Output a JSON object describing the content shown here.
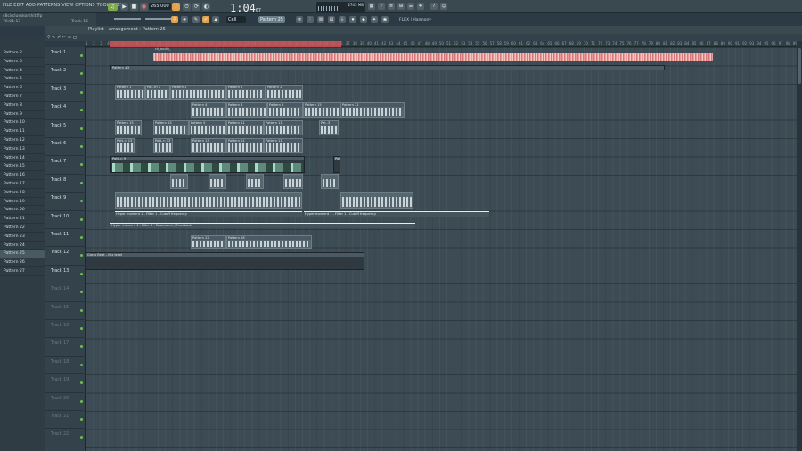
{
  "menu": [
    "FILE",
    "EDIT",
    "ADD",
    "PATTERNS",
    "VIEW",
    "OPTIONS",
    "TOOLS",
    "HELP"
  ],
  "info": {
    "project": "c8circlusskorshit.flp",
    "position": "76:01:13",
    "track_hint": "Track 16"
  },
  "transport": {
    "tempo": "265.000",
    "song_time": "1:04",
    "song_time_small": "67",
    "pattern": "Pattern 25",
    "snap": "Cell",
    "mixer": "FLEX | Harmony",
    "cpu": "2745 MB"
  },
  "playlist": {
    "breadcrumb": "Playlist - Arrangement › Pattern 25"
  },
  "browser": {
    "items": [
      "Pattern 2",
      "Pattern 3",
      "Pattern 4",
      "Pattern 5",
      "Pattern 6",
      "Pattern 7",
      "Pattern 8",
      "Pattern 9",
      "Pattern 10",
      "Pattern 11",
      "Pattern 12",
      "Pattern 13",
      "Pattern 14",
      "Pattern 15",
      "Pattern 16",
      "Pattern 17",
      "Pattern 18",
      "Pattern 19",
      "Pattern 20",
      "Pattern 21",
      "Pattern 22",
      "Pattern 23",
      "Pattern 24",
      "Pattern 25",
      "Pattern 26",
      "Pattern 27"
    ],
    "selected": "Pattern 25"
  },
  "tracks": [
    "Track 1",
    "Track 2",
    "Track 3",
    "Track 4",
    "Track 5",
    "Track 6",
    "Track 7",
    "Track 8",
    "Track 9",
    "Track 10",
    "Track 11",
    "Track 12",
    "Track 13",
    "Track 14",
    "Track 15",
    "Track 16",
    "Track 17",
    "Track 18",
    "Track 19",
    "Track 20",
    "Track 21",
    "Track 22"
  ],
  "clips": {
    "t1_audio": "ck_audio_",
    "t2": "Pattern #2",
    "t3": [
      "Pattern 1",
      "Pat..rn 1",
      "Pattern 1",
      "Pattern 2",
      "Pattern 2"
    ],
    "t4": [
      "Pattern 4",
      "Pattern 4",
      "Pattern 5",
      "Pattern 15",
      "Pattern 21"
    ],
    "t5": [
      "Pattern 15",
      "Pattern 15",
      "Pattern 5",
      "Pattern 11",
      "Pattern 11",
      "Pat..3"
    ],
    "t6": [
      "Patt..n 13",
      "Patt..n 13",
      "Pattern 13",
      "Pattern 11",
      "Pattern 11"
    ],
    "t7": [
      "Patt..n 9",
      "Patt..n 9"
    ],
    "t10": [
      "Hyper moment 1 - Filter 1 - Cutoff frequency",
      "Hyper moment 1 - Filter 1 - Cutoff frequency"
    ],
    "t11": "Hyper moment 4 - Filter 1 - Resonance / Feedback",
    "t12": [
      "Pattern 22",
      "Pattern 18"
    ],
    "t13": "Gross Beat - Mix level"
  }
}
